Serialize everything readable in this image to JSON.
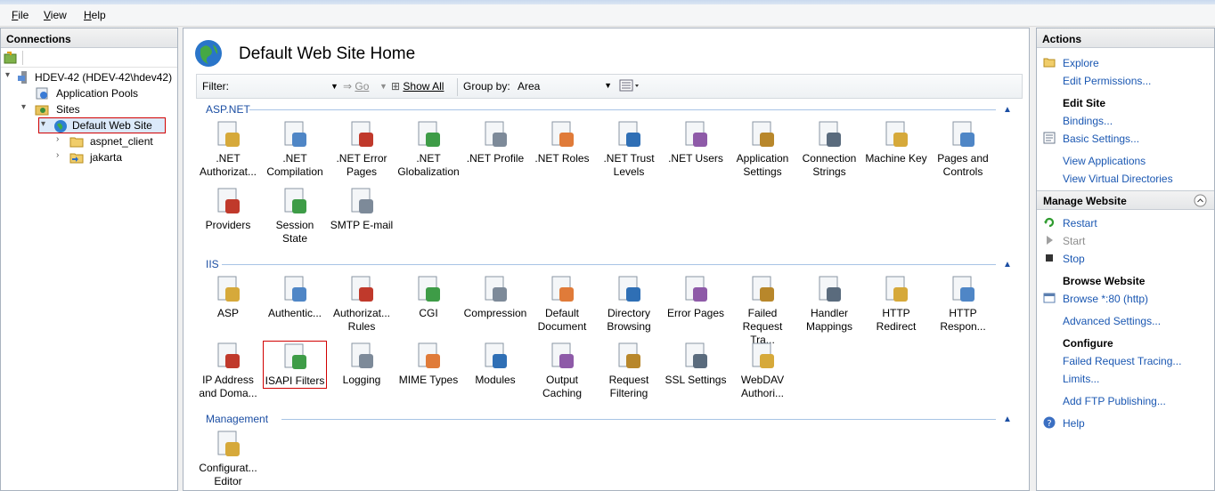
{
  "menu": {
    "file": "File",
    "file_key": "F",
    "file_rest": "ile",
    "view_key": "V",
    "view_rest": "iew",
    "help_key": "H",
    "help_rest": "elp"
  },
  "connections": {
    "title": "Connections",
    "tree": [
      {
        "label": "HDEV-42 (HDEV-42\\hdev42)"
      },
      {
        "label": "Application Pools"
      },
      {
        "label": "Sites"
      },
      {
        "label": "Default Web Site"
      },
      {
        "label": "aspnet_client"
      },
      {
        "label": "jakarta"
      }
    ]
  },
  "center": {
    "title": "Default Web Site Home",
    "filter": {
      "label": "Filter:",
      "value": "",
      "go": "Go",
      "show_all": "Show All",
      "group_by_label": "Group by:",
      "group_by_value": "Area"
    },
    "sections": {
      "aspnet": {
        "title": "ASP.NET"
      },
      "iis": {
        "title": "IIS"
      },
      "management": {
        "title": "Management"
      }
    },
    "aspnet_features": [
      [
        "",
        ".NET",
        "Authorizat..."
      ],
      [
        ".NET",
        "Compilation"
      ],
      [
        ".NET Error",
        "Pages"
      ],
      [
        ".NET",
        "Globalization"
      ],
      [
        ".NET Profile"
      ],
      [
        ".NET Roles"
      ],
      [
        ".NET Trust",
        "Levels"
      ],
      [
        ".NET Users"
      ],
      [
        "Application",
        "Settings"
      ],
      [
        "Connection",
        "Strings"
      ],
      [
        "Machine Key"
      ],
      [
        "Pages and",
        "Controls"
      ],
      [
        "Providers"
      ],
      [
        "Session State"
      ],
      [
        "SMTP E-mail"
      ]
    ],
    "aspnet_labels": [
      ".NET\nAuthorizat...",
      ".NET\nCompilation",
      ".NET Error\nPages",
      ".NET\nGlobalization",
      ".NET Profile",
      ".NET Roles",
      ".NET Trust\nLevels",
      ".NET Users",
      "Application\nSettings",
      "Connection\nStrings",
      "Machine Key",
      "Pages and\nControls",
      "Providers",
      "Session State",
      "SMTP E-mail"
    ],
    "iis_labels": [
      "ASP",
      "Authentic...",
      "Authorizat...\nRules",
      "CGI",
      "Compression",
      "Default\nDocument",
      "Directory\nBrowsing",
      "Error Pages",
      "Failed\nRequest Tra...",
      "Handler\nMappings",
      "HTTP\nRedirect",
      "HTTP\nRespon...",
      "IP Address\nand Doma...",
      "ISAPI Filters",
      "Logging",
      "MIME Types",
      "Modules",
      "Output\nCaching",
      "Request\nFiltering",
      "SSL Settings",
      "WebDAV\nAuthori..."
    ],
    "management_labels": [
      "Configurat...\nEditor"
    ]
  },
  "actions": {
    "title": "Actions",
    "explore": "Explore",
    "edit_permissions": "Edit Permissions...",
    "edit_site": "Edit Site",
    "bindings": "Bindings...",
    "basic_settings": "Basic Settings...",
    "view_applications": "View Applications",
    "view_virtual_dirs": "View Virtual Directories",
    "manage_website": "Manage Website",
    "restart": "Restart",
    "start": "Start",
    "stop": "Stop",
    "browse_website": "Browse Website",
    "browse_80": "Browse *:80 (http)",
    "advanced_settings": "Advanced Settings...",
    "configure": "Configure",
    "failed_request_tracing": "Failed Request Tracing...",
    "limits": "Limits...",
    "add_ftp": "Add FTP Publishing...",
    "help": "Help"
  }
}
